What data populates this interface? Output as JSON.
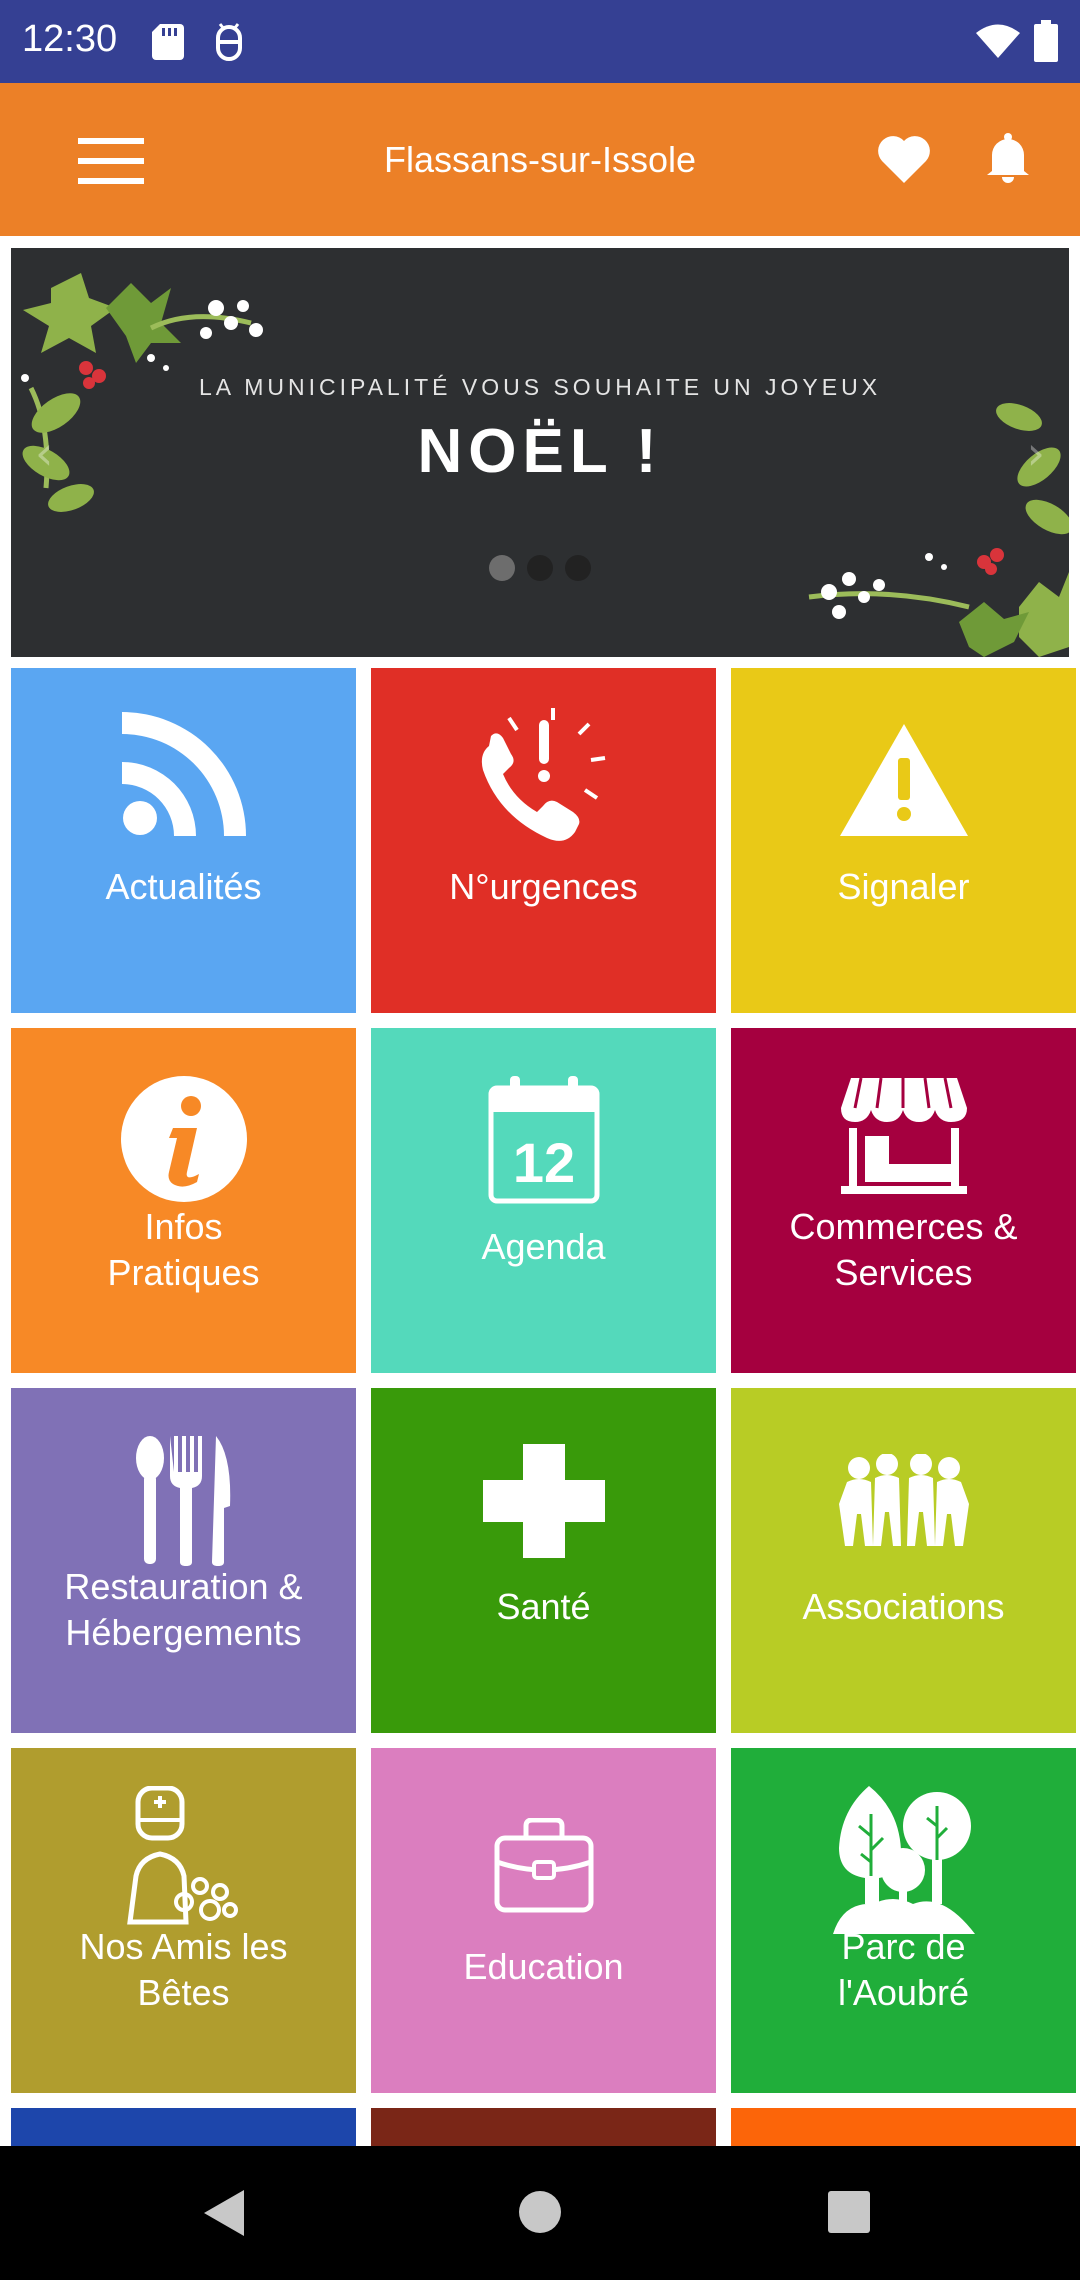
{
  "status_bar": {
    "time": "12:30"
  },
  "app_bar": {
    "title": "Flassans-sur-Issole"
  },
  "banner": {
    "line1": "LA MUNICIPALITÉ VOUS SOUHAITE UN JOYEUX",
    "line2": "NOËL !",
    "prev_arrow": "‹",
    "next_arrow": "›"
  },
  "tiles": [
    {
      "label": "Actualités",
      "color": "#5aa6f2",
      "icon": "rss-icon"
    },
    {
      "label": "N°urgences",
      "color": "#e02f26",
      "icon": "emergency-phone-icon"
    },
    {
      "label": "Signaler",
      "color": "#e9c917",
      "icon": "warning-icon"
    },
    {
      "label": "Infos\nPratiques",
      "color": "#f78926",
      "icon": "info-icon"
    },
    {
      "label": "Agenda",
      "color": "#54d9bb",
      "icon": "calendar-icon"
    },
    {
      "label": "Commerces &\nServices",
      "color": "#a5003f",
      "icon": "shop-icon"
    },
    {
      "label": "Restauration &\nHébergements",
      "color": "#8071b6",
      "icon": "cutlery-icon"
    },
    {
      "label": "Santé",
      "color": "#399a0a",
      "icon": "health-cross-icon"
    },
    {
      "label": "Associations",
      "color": "#b8cc25",
      "icon": "people-group-icon"
    },
    {
      "label": "Nos Amis les\nBêtes",
      "color": "#b09d2e",
      "icon": "vet-icon"
    },
    {
      "label": "Education",
      "color": "#db7ebf",
      "icon": "briefcase-icon"
    },
    {
      "label": "Parc de\nl'Aoubré",
      "color": "#20ae3a",
      "icon": "trees-icon"
    }
  ],
  "partial_tiles": [
    {
      "color": "#1d46ab"
    },
    {
      "color": "#7a2617"
    },
    {
      "color": "#fc6509"
    }
  ],
  "calendar_day": "12"
}
